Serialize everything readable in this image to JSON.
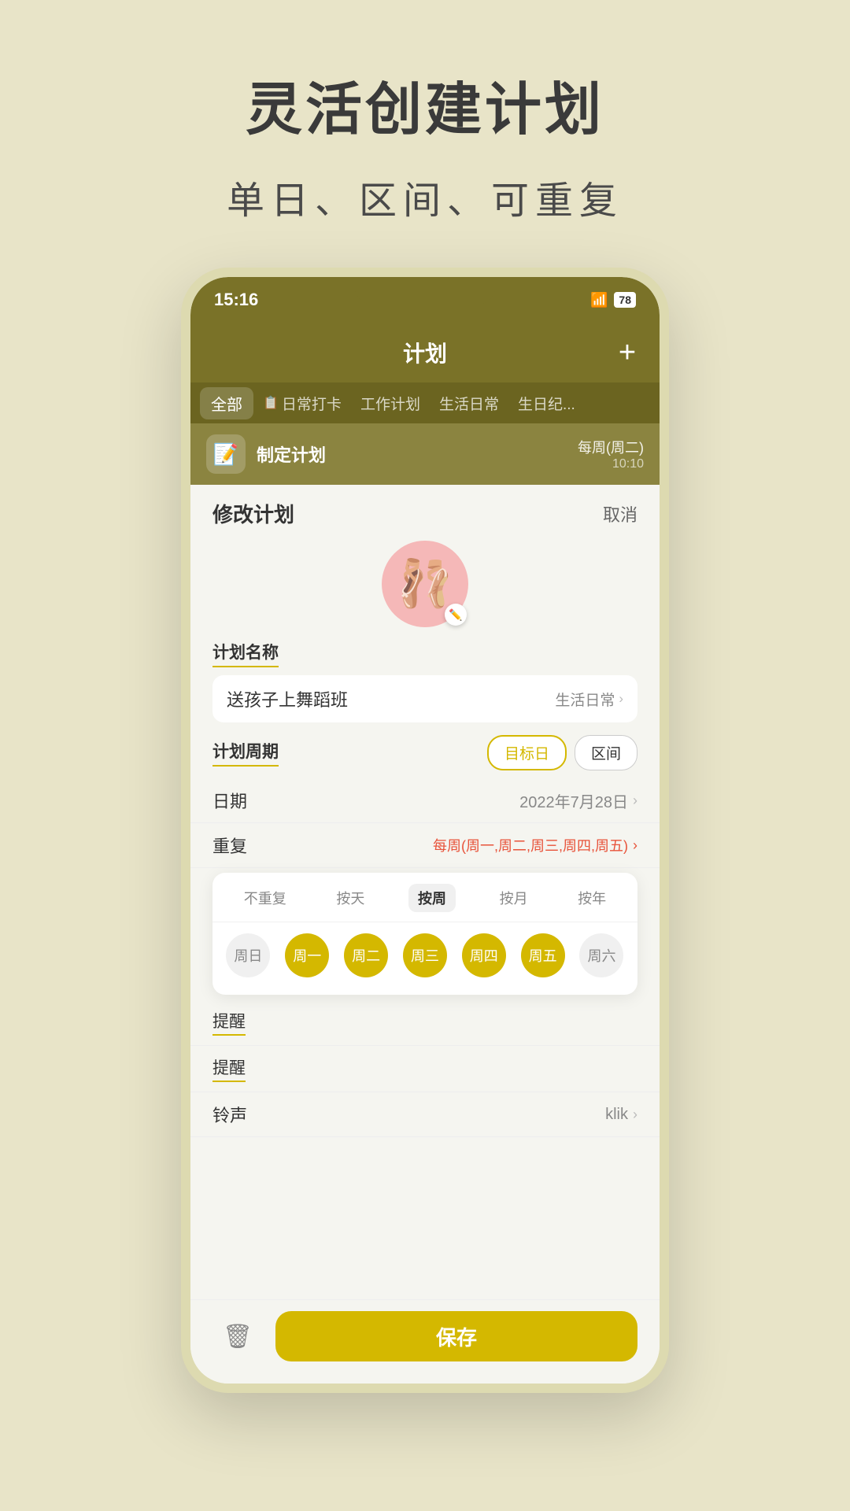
{
  "page": {
    "title": "灵活创建计划",
    "subtitle": "单日、区间、可重复",
    "background": "#e8e4c8"
  },
  "status_bar": {
    "time": "15:16",
    "battery": "78",
    "wifi": "WiFi"
  },
  "app_header": {
    "title": "计划",
    "add_button": "+"
  },
  "tabs": [
    {
      "label": "全部",
      "active": true
    },
    {
      "label": "日常打卡",
      "active": false,
      "icon": "📋"
    },
    {
      "label": "工作计划",
      "active": false
    },
    {
      "label": "生活日常",
      "active": false
    },
    {
      "label": "生日纪...",
      "active": false
    }
  ],
  "plan_preview": {
    "icon": "📝",
    "name": "制定计划",
    "repeat": "每周(周二)",
    "time": "10:10"
  },
  "form": {
    "title": "修改计划",
    "cancel": "取消",
    "avatar_emoji": "🩰",
    "edit_icon": "✏️",
    "field_name_label": "计划名称",
    "plan_name_value": "送孩子上舞蹈班",
    "category_label": "生活日常",
    "period_label": "计划周期",
    "period_btn1": "目标日",
    "period_btn2": "区间",
    "date_label": "日期",
    "date_value": "2022年7月28日",
    "repeat_label": "重复",
    "repeat_value": "每周(周一,周二,周三,周四,周五)",
    "reminder_label1": "提醒",
    "reminder_label2": "提醒",
    "ringtone_label": "铃声",
    "ringtone_value": "klik"
  },
  "repeat_dropdown": {
    "tabs": [
      "不重复",
      "按天",
      "按周",
      "按月",
      "按年"
    ],
    "active_tab": "按周",
    "weekdays": [
      {
        "label": "周日",
        "selected": false
      },
      {
        "label": "周一",
        "selected": true
      },
      {
        "label": "周二",
        "selected": true
      },
      {
        "label": "周三",
        "selected": true
      },
      {
        "label": "周四",
        "selected": true
      },
      {
        "label": "周五",
        "selected": true
      },
      {
        "label": "周六",
        "selected": false
      }
    ]
  },
  "bottom": {
    "trash_icon": "🗑",
    "save_label": "保存"
  }
}
